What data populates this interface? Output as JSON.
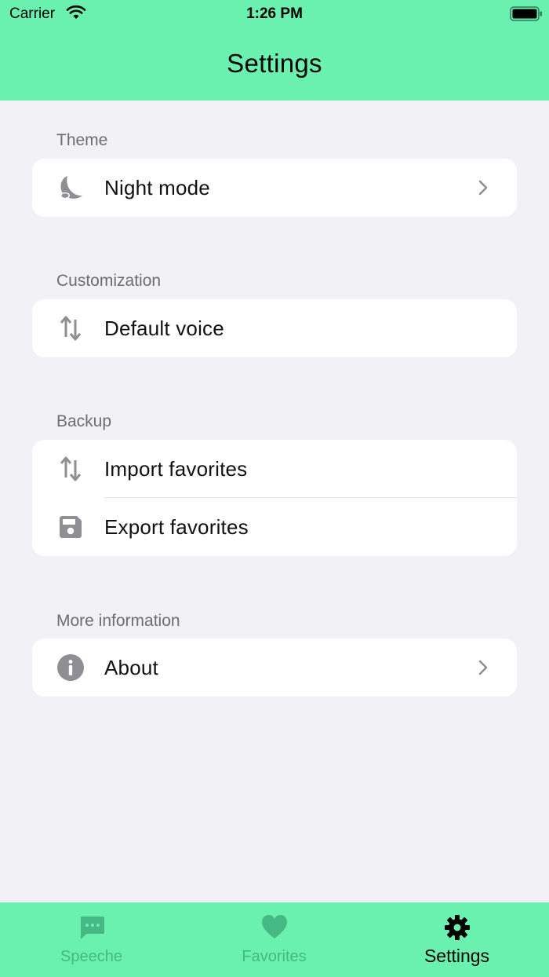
{
  "status_bar": {
    "carrier": "Carrier",
    "time": "1:26 PM"
  },
  "header": {
    "title": "Settings"
  },
  "colors": {
    "accent": "#6af1b0",
    "tab_inactive": "#46b884",
    "icon_gray": "#8e8e93",
    "background": "#f2f1f6"
  },
  "sections": [
    {
      "title": "Theme",
      "items": [
        {
          "label": "Night mode",
          "icon": "moon-icon",
          "chevron": true
        }
      ]
    },
    {
      "title": "Customization",
      "items": [
        {
          "label": "Default voice",
          "icon": "swap-vertical-icon",
          "chevron": false
        }
      ]
    },
    {
      "title": "Backup",
      "items": [
        {
          "label": "Import favorites",
          "icon": "swap-vertical-icon",
          "chevron": false
        },
        {
          "label": "Export favorites",
          "icon": "floppy-disk-icon",
          "chevron": false
        }
      ]
    },
    {
      "title": "More information",
      "items": [
        {
          "label": "About",
          "icon": "info-icon",
          "chevron": true
        }
      ]
    }
  ],
  "tabbar": {
    "tabs": [
      {
        "label": "Speeche",
        "icon": "chat-bubble-icon",
        "active": false
      },
      {
        "label": "Favorites",
        "icon": "heart-icon",
        "active": false
      },
      {
        "label": "Settings",
        "icon": "gear-icon",
        "active": true
      }
    ]
  }
}
